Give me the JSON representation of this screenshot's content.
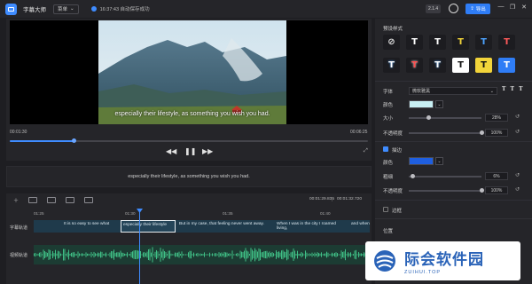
{
  "header": {
    "app_title": "字幕大师",
    "menu_label": "菜单",
    "save_status": "16:37:43 自动保存成功",
    "version": "2.1.4",
    "export_label": "导出",
    "brand_color": "#3f8cff"
  },
  "player": {
    "subtitle_text": "especially their lifestyle, as something you wish you had.",
    "current_time": "00:01:30",
    "total_time": "00:06:25",
    "progress_fraction": 0.18
  },
  "subtitle_editor": {
    "text": "especially their lifestyle, as something you wish you had."
  },
  "timeline": {
    "current_position": "00:01:29.835",
    "total_duration": "00:01:32.720",
    "ruler_ticks": [
      "01:25",
      "01:30",
      "01:35",
      "01:40"
    ],
    "subtitle_track_label": "字幕轨道",
    "audio_track_label": "视频轨道",
    "clips": [
      {
        "text": "It is so easy to see what"
      },
      {
        "text": "especially their lifestyle",
        "selected": true
      },
      {
        "text": "But in my case, that feeling never went away."
      },
      {
        "text": "When I was in the city I roamed living,"
      },
      {
        "text": "and when I"
      }
    ]
  },
  "style_panel": {
    "title": "预设样式",
    "presets": [
      {
        "glyph": "⊘",
        "fg": "#e0e0e0",
        "bg": "#1c1c20"
      },
      {
        "glyph": "T",
        "fg": "#ffffff",
        "bg": "#1c1c20"
      },
      {
        "glyph": "T",
        "fg": "#ffffff",
        "bg": "#1c1c20"
      },
      {
        "glyph": "T",
        "fg": "#f2d43a",
        "bg": "#1c1c20"
      },
      {
        "glyph": "T",
        "fg": "#4da3ff",
        "bg": "#1c1c20"
      },
      {
        "glyph": "T",
        "fg": "#ff5a5a",
        "bg": "#1c1c20"
      },
      {
        "glyph": "T",
        "fg": "#ffffff",
        "bg": "#1c1c20"
      },
      {
        "glyph": "T",
        "fg": "#ff4d4d",
        "bg": "#1c1c20"
      },
      {
        "glyph": "T",
        "fg": "#ffffff",
        "bg": "#1c1c20"
      },
      {
        "glyph": "T",
        "fg": "#111111",
        "bg": "#ffffff"
      },
      {
        "glyph": "T",
        "fg": "#111111",
        "bg": "#f2d43a"
      },
      {
        "glyph": "T",
        "fg": "#ffffff",
        "bg": "#2f7df6"
      }
    ],
    "font_label": "字体",
    "font_value": "微软雅黑",
    "font_styles": "T T T",
    "color_label": "颜色",
    "text_color": "#c8f0f4",
    "size_label": "大小",
    "size_value": "28%",
    "size_fraction": 0.28,
    "opacity_label": "不透明度",
    "opacity_value": "100%",
    "opacity_fraction": 1.0,
    "stroke_label": "描边",
    "stroke_color_label": "颜色",
    "stroke_color": "#1f5fe0",
    "stroke_width_label": "粗细",
    "stroke_width_value": "6%",
    "stroke_width_fraction": 0.06,
    "stroke_opacity_label": "不透明度",
    "stroke_opacity_value": "100%",
    "stroke_opacity_fraction": 1.0,
    "border_label": "边框",
    "position_label": "位置"
  },
  "watermark": {
    "main": "际会软件园",
    "sub": "ZUIHUI.TOP"
  }
}
